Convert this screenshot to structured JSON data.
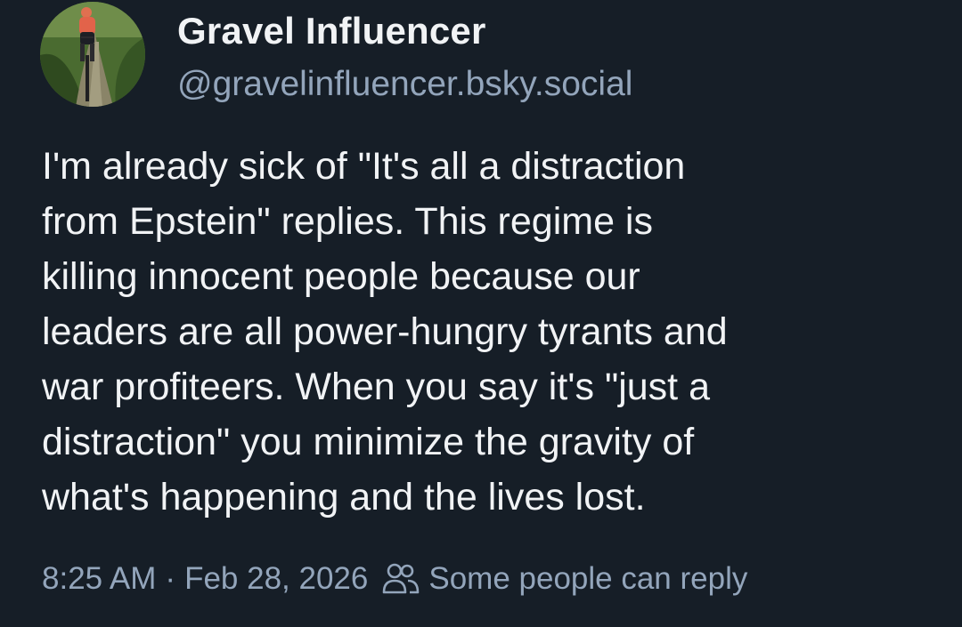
{
  "post": {
    "author": {
      "display_name": "Gravel Influencer",
      "handle": "@gravelinfluencer.bsky.social",
      "avatar_icon": "cyclist-on-gravel-path-photo"
    },
    "text_lines": [
      "I'm already sick of \"It's all a distraction",
      "from Epstein\" replies. This regime is",
      "killing innocent people because our",
      "leaders are all power-hungry tyrants and",
      "war profiteers. When you say it's \"just a",
      "distraction\" you minimize the gravity of",
      "what's happening and the lives lost."
    ],
    "time": "8:25 AM",
    "separator": "·",
    "date": "Feb 28, 2026",
    "reply_setting_icon": "people-icon",
    "reply_setting": "Some people can reply"
  },
  "colors": {
    "background": "#161e27",
    "text_primary": "#f1f3f5",
    "text_secondary": "#93a5bb"
  }
}
